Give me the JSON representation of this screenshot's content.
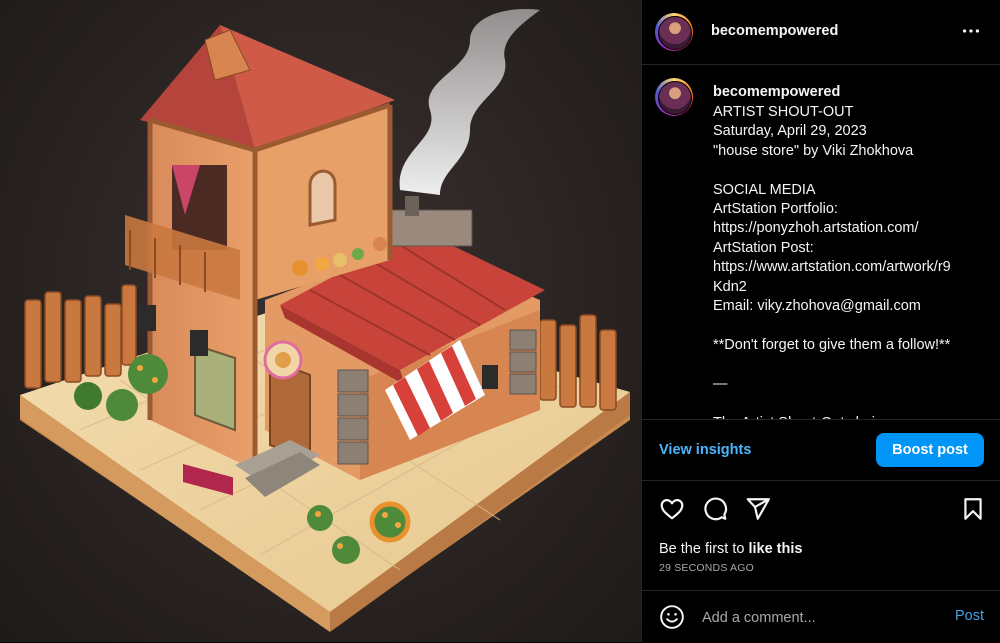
{
  "post": {
    "username": "becomempowered",
    "caption_lines": "ARTIST SHOUT-OUT\nSaturday, April 29, 2023\n\"house store\" by Viki Zhokhova\n\nSOCIAL MEDIA\nArtStation Portfolio:\nhttps://ponyzhoh.artstation.com/\nArtStation Post:\nhttps://www.artstation.com/artwork/r9\nKdn2\nEmail: viky.zhohova@gmail.com\n\n**Don't forget to give them a follow!**\n\n—\n\nThe Artist Shout-Out choice was",
    "view_insights": "View insights",
    "boost_post": "Boost post",
    "likes_prefix": "Be the first to ",
    "likes_link": "like this",
    "timestamp": "29 SECONDS AGO",
    "comment_placeholder": "Add a comment...",
    "post_label": "Post"
  },
  "icons": {
    "more": "more-horizontal-icon",
    "like": "heart-icon",
    "comment": "comment-bubble-icon",
    "share": "paper-plane-icon",
    "save": "bookmark-icon",
    "emoji": "emoji-smiley-icon"
  },
  "colors": {
    "link": "#4cb5f9",
    "button": "#0095f6",
    "background": "#000000"
  }
}
